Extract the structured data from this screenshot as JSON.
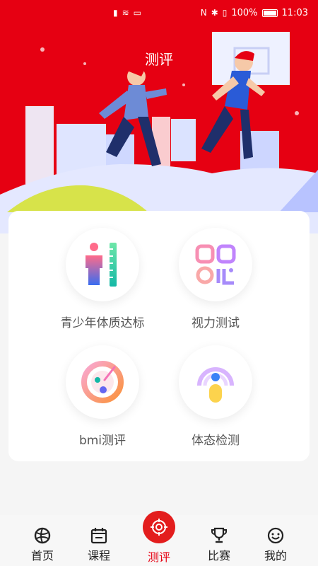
{
  "status_bar": {
    "battery": "100%",
    "time": "11:03"
  },
  "header": {
    "title": "测评"
  },
  "menu": {
    "items": [
      {
        "label": "青少年体质达标",
        "icon": "height-ruler-icon"
      },
      {
        "label": "视力测试",
        "icon": "vision-chart-icon"
      },
      {
        "label": "bmi测评",
        "icon": "gauge-icon"
      },
      {
        "label": "体态检测",
        "icon": "posture-person-icon"
      }
    ]
  },
  "tabbar": {
    "tabs": [
      {
        "label": "首页",
        "icon": "ball-icon",
        "active": false
      },
      {
        "label": "课程",
        "icon": "calendar-icon",
        "active": false
      },
      {
        "label": "测评",
        "icon": "target-icon",
        "active": true
      },
      {
        "label": "比赛",
        "icon": "trophy-icon",
        "active": false
      },
      {
        "label": "我的",
        "icon": "smile-icon",
        "active": false
      }
    ]
  },
  "colors": {
    "brand_red": "#e60012",
    "active_tab": "#e60012"
  }
}
